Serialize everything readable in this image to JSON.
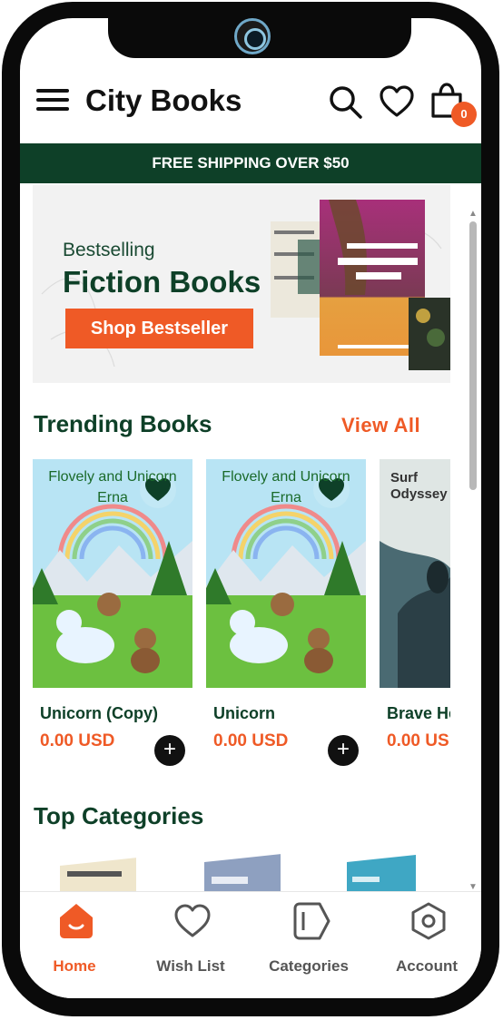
{
  "app": {
    "title": "City Books",
    "cart_count": "0"
  },
  "shipping_banner": {
    "text": "FREE SHIPPING OVER $50"
  },
  "hero": {
    "subtitle": "Bestselling",
    "title": "Fiction Books",
    "button": "Shop Bestseller"
  },
  "trending": {
    "title": "Trending Books",
    "view_all": "View All",
    "products": [
      {
        "name": "Unicorn (Copy)",
        "price": "0.00 USD",
        "cover_title": "Flovely and Unicorn Erna"
      },
      {
        "name": "Unicorn",
        "price": "0.00 USD",
        "cover_title": "Flovely and Unicorn Erna"
      },
      {
        "name": "Brave He",
        "price": "0.00 US",
        "cover_title": "Surf Odyssey"
      }
    ]
  },
  "categories": {
    "title": "Top Categories"
  },
  "bottom_nav": [
    {
      "label": "Home",
      "icon": "home-icon",
      "active": true
    },
    {
      "label": "Wish List",
      "icon": "heart-icon",
      "active": false
    },
    {
      "label": "Categories",
      "icon": "tag-icon",
      "active": false
    },
    {
      "label": "Account",
      "icon": "hexagon-icon",
      "active": false
    }
  ],
  "colors": {
    "brand_green": "#0e4028",
    "accent_orange": "#ef5a26"
  }
}
